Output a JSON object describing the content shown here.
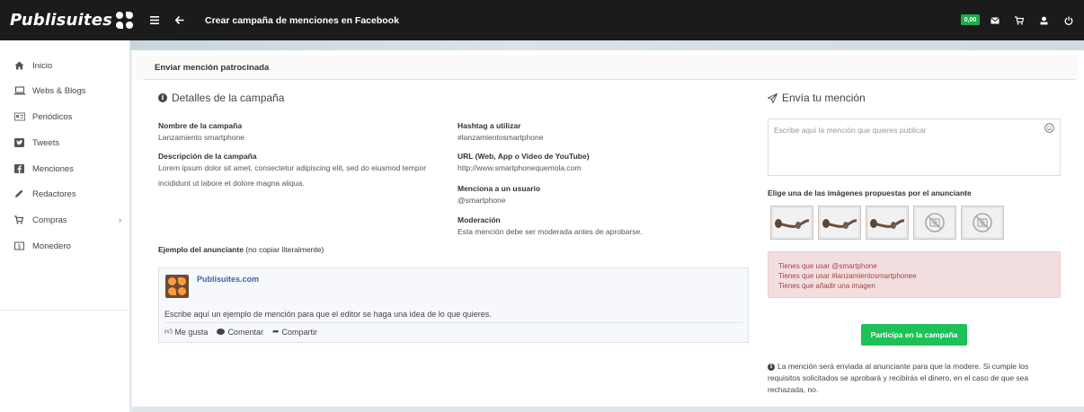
{
  "brand": {
    "name": "Publisuites"
  },
  "topbar": {
    "title": "Crear campaña de menciones en Facebook",
    "balance": "0,00",
    "icons": [
      "menu-icon",
      "back-arrow-icon",
      "mail-icon",
      "cart-icon",
      "user-icon",
      "power-icon"
    ]
  },
  "sidebar": {
    "items": [
      {
        "label": "Inicio",
        "icon": "home-icon"
      },
      {
        "label": "Webs & Blogs",
        "icon": "laptop-icon"
      },
      {
        "label": "Periódicos",
        "icon": "newspaper-icon"
      },
      {
        "label": "Tweets",
        "icon": "twitter-icon"
      },
      {
        "label": "Menciones",
        "icon": "facebook-icon"
      },
      {
        "label": "Redactores",
        "icon": "pencil-icon"
      },
      {
        "label": "Compras",
        "icon": "cart-icon",
        "chevron": "›"
      },
      {
        "label": "Monedero",
        "icon": "wallet-icon"
      }
    ]
  },
  "panel": {
    "heading": "Enviar mención patrocinada"
  },
  "details": {
    "title": "Detalles de la campaña",
    "campaign_name_label": "Nombre de la campaña",
    "campaign_name": "Lanzamiento smartphone",
    "description_label": "Descripción de la campaña",
    "description_line1": "Lorem ipsum dolor sit amet, consectetur adipiscing elit, sed do eiusmod tempor",
    "description_line2": "incididunt ut labore et dolore magna aliqua.",
    "hashtag_label": "Hashtag a utilizar",
    "hashtag": "#lanzamientosmartphone",
    "url_label": "URL (Web, App o Video de YouTube)",
    "url": "http://www.smartphonequemola.com",
    "mention_label": "Menciona a un usuario",
    "mention": "@smartphone",
    "moderation_label": "Moderación",
    "moderation": "Esta mención debe ser moderada antes de aprobarse.",
    "example_label": "Ejemplo del anunciante",
    "example_note": "(no copiar literalmente)"
  },
  "fb_example": {
    "page_name": "Publisuites.com",
    "text": "Escribe aquí un ejemplo de mención para que el editor se haga una idea de lo que quieres.",
    "like": "Me gusta",
    "comment": "Comentar",
    "share": "Compartir"
  },
  "send": {
    "title": "Envía tu mención",
    "placeholder": "Escribe aquí la mención que quieres publicar",
    "images_label": "Elige una de las imágenes propuestas por el anunciante",
    "alerts": [
      "Tienes que usar @smartphone",
      "Tienes que usar #lanzamientosmartphonee",
      "Tienes que añadir una imagen"
    ],
    "button": "Participa en la campaña",
    "note_line1": "La mención será enviada al anunciante para que la modere. Si cumple los",
    "note_line2": "requisitos solicitados se aprobará y recibirás el dinero, en el caso de que sea",
    "note_line3": "rechazada, no."
  },
  "colors": {
    "topbar": "#1b1b1b",
    "accent_green": "#1cc157",
    "alert_bg": "#f2dede",
    "link_blue": "#3b63b1"
  }
}
